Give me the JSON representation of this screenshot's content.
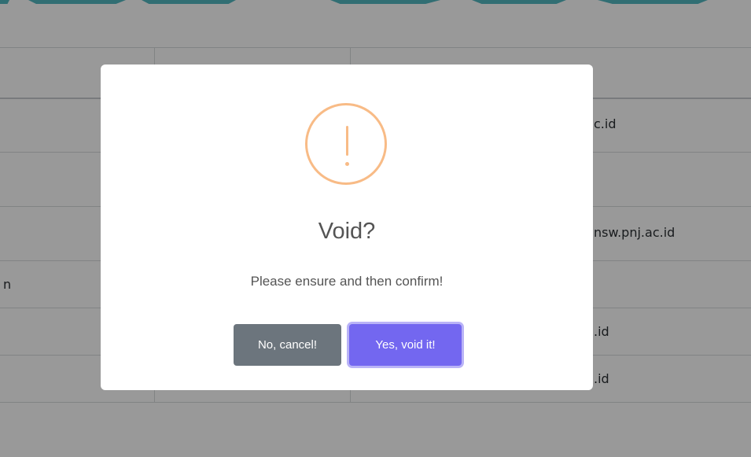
{
  "table": {
    "rows": [
      {
        "col1": "",
        "col3": "c.id"
      },
      {
        "col1": "",
        "col3": ""
      },
      {
        "col1": "",
        "col3": "nsw.pnj.ac.id"
      },
      {
        "col1": "n",
        "col3": ""
      },
      {
        "col1": "",
        "col3": ".id"
      },
      {
        "col1": "",
        "col3": ".id"
      }
    ]
  },
  "dialog": {
    "icon": "warning-exclamation-icon",
    "icon_color": "#f8bb86",
    "title": "Void?",
    "message": "Please ensure and then confirm!",
    "cancel_label": "No, cancel!",
    "confirm_label": "Yes, void it!",
    "confirm_color": "#7367f0",
    "cancel_color": "#6c757d"
  }
}
